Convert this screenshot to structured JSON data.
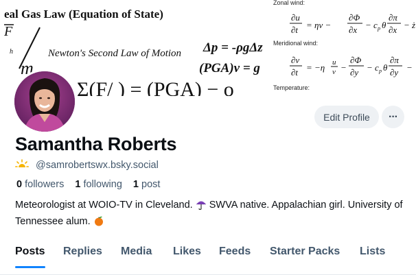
{
  "banner": {
    "gas_law_title": "eal Gas Law (Equation of State)",
    "newton_title": "Newton's Second Law of Motion",
    "dp_formula": "Δp = -ρgΔz",
    "pga_formula": "(PGA)v = g",
    "f_formula": "Σ(F/ ) = (PGA) − o",
    "zonal_label": "Zonal wind:",
    "meridional_label": "Meridional wind:",
    "temperature_label": "Temperature:"
  },
  "profile": {
    "display_name": "Samantha Roberts",
    "handle": "@samrobertswx.bsky.social",
    "followers_count": "0",
    "followers_label": "followers",
    "following_count": "1",
    "following_label": "following",
    "posts_count": "1",
    "posts_label": "post",
    "bio_part1": "Meteorologist at WOIO-TV in Cleveland.",
    "bio_part2": "SWVA native. Appalachian girl.",
    "bio_part3": "University of Tennessee alum.",
    "bio_emojis": [
      "umbrella-emoji",
      "orange-emoji"
    ]
  },
  "actions": {
    "edit_label": "Edit Profile",
    "more_label": "···"
  },
  "tabs": [
    {
      "label": "Posts",
      "active": true
    },
    {
      "label": "Replies",
      "active": false
    },
    {
      "label": "Media",
      "active": false
    },
    {
      "label": "Likes",
      "active": false
    },
    {
      "label": "Feeds",
      "active": false
    },
    {
      "label": "Starter Packs",
      "active": false
    },
    {
      "label": "Lists",
      "active": false
    }
  ],
  "colors": {
    "accent": "#1083fe",
    "text": "#0b0f14",
    "muted": "#42576c",
    "button_bg": "#eef1f4"
  }
}
